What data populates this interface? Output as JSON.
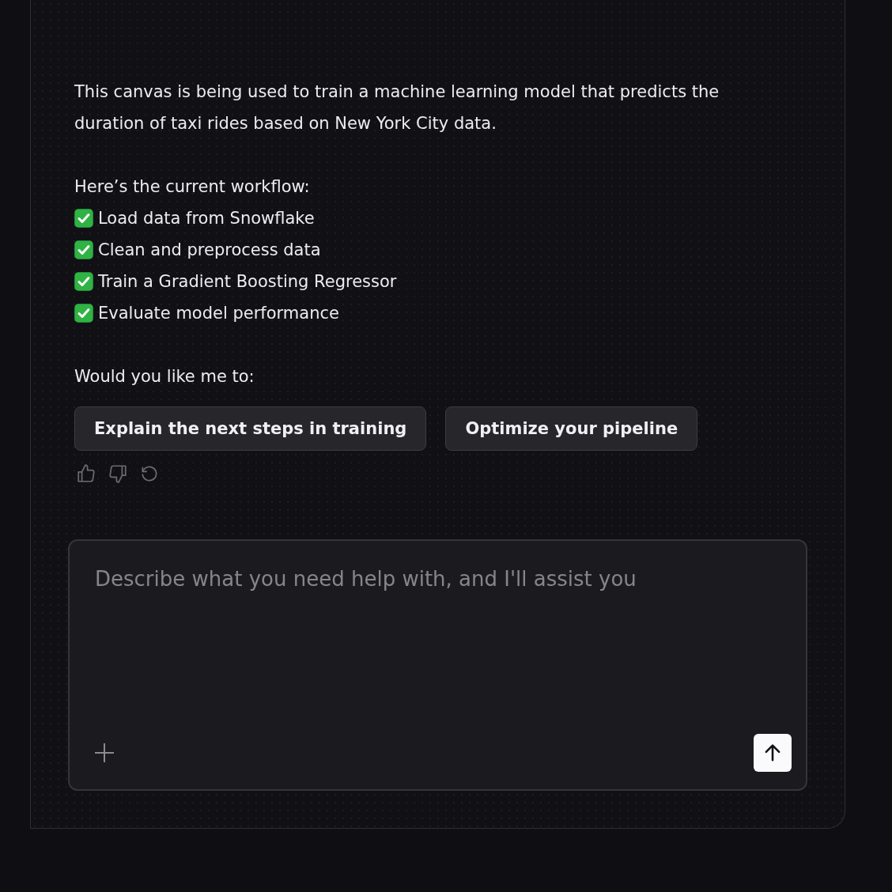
{
  "message": {
    "intro": "This canvas is being used to train a machine learning model that predicts the duration of taxi rides based on New York City data.",
    "workflow_heading": "Here’s the current workflow:",
    "steps": [
      {
        "label": "Load data from Snowflake",
        "checked": true
      },
      {
        "label": "Clean and preprocess data",
        "checked": true
      },
      {
        "label": "Train a Gradient Boosting Regressor",
        "checked": true
      },
      {
        "label": "Evaluate model performance",
        "checked": true
      }
    ],
    "question": "Would you like me to:",
    "suggestions": [
      "Explain the next steps in training",
      "Optimize your pipeline"
    ]
  },
  "composer": {
    "placeholder": "Describe what you need help with, and I'll assist you"
  }
}
